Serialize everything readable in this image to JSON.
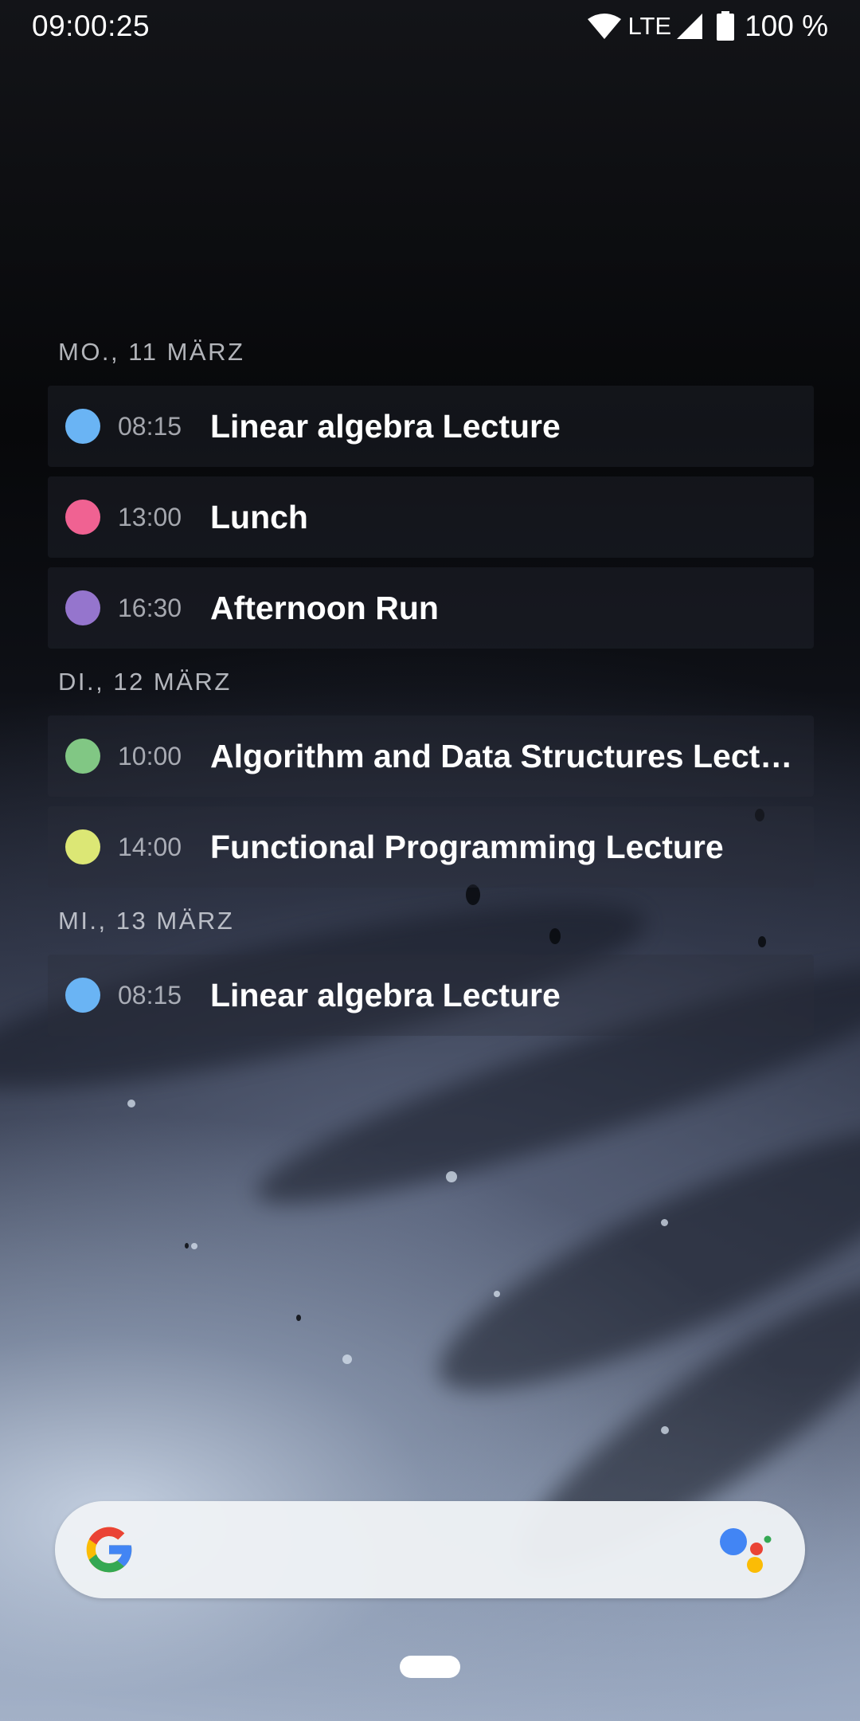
{
  "status_bar": {
    "time": "09:00:25",
    "network": "LTE",
    "battery": "100 %",
    "icons": [
      "wifi-icon",
      "signal-icon",
      "battery-icon"
    ]
  },
  "agenda": {
    "days": [
      {
        "header": "MO., 11 MÄRZ",
        "events": [
          {
            "time": "08:15",
            "title": "Linear algebra Lecture",
            "color": "#6ab4f4"
          },
          {
            "time": "13:00",
            "title": "Lunch",
            "color": "#f06292"
          },
          {
            "time": "16:30",
            "title": "Afternoon Run",
            "color": "#9575cd"
          }
        ]
      },
      {
        "header": "DI., 12 MÄRZ",
        "events": [
          {
            "time": "10:00",
            "title": "Algorithm and Data Structures Lecture",
            "color": "#81c784"
          },
          {
            "time": "14:00",
            "title": "Functional Programming Lecture",
            "color": "#dce775"
          }
        ]
      },
      {
        "header": "MI., 13 MÄRZ",
        "events": [
          {
            "time": "08:15",
            "title": "Linear algebra Lecture",
            "color": "#6ab4f4"
          }
        ]
      }
    ]
  },
  "search_bar": {
    "logo": "google-g-icon",
    "assistant": "google-assistant-icon"
  },
  "colors": {
    "google_blue": "#4285f4",
    "google_red": "#ea4335",
    "google_yellow": "#fbbc05",
    "google_green": "#34a853"
  }
}
